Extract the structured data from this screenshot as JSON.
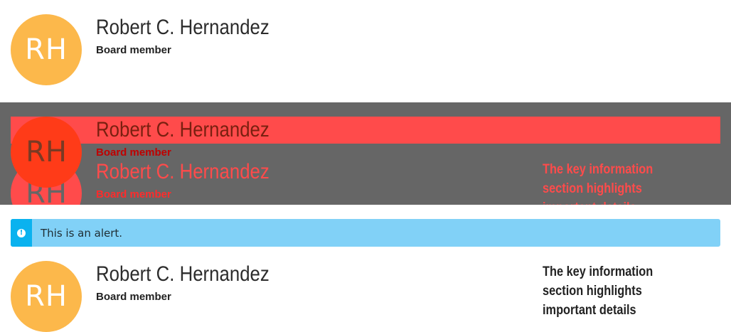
{
  "profile": {
    "initials": "RH",
    "name": "Robert C. Hernandez",
    "role": "Board member"
  },
  "key_info": {
    "line1": "The key information",
    "line2": "section highlights",
    "line3": "important details"
  },
  "alert": {
    "message": "This is an alert.",
    "icon": "exclamation-circle-icon"
  },
  "colors": {
    "avatar": "#fcb84b",
    "overlay": "#666666",
    "highlight": "#ff4b4b",
    "alert_bg": "#81d1f7",
    "alert_accent": "#0ab2ef"
  }
}
